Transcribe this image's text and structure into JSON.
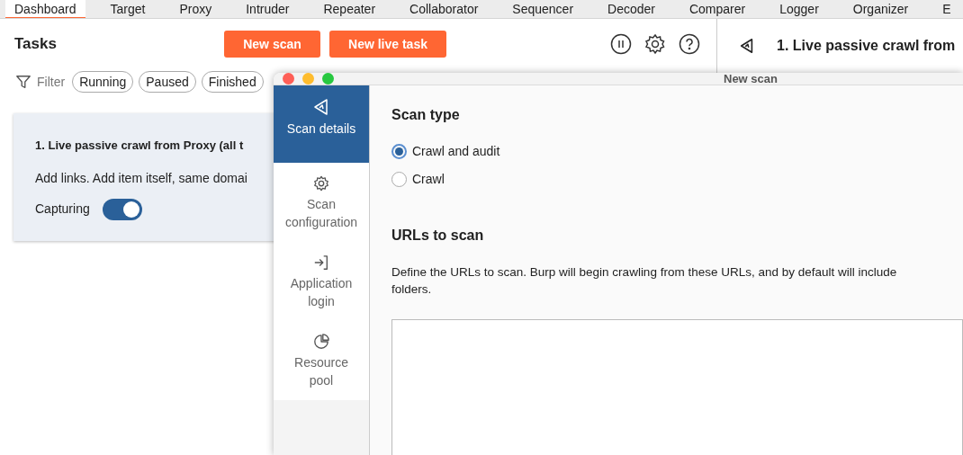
{
  "tabs": [
    {
      "label": "Dashboard",
      "selected": true
    },
    {
      "label": "Target",
      "selected": false
    },
    {
      "label": "Proxy",
      "selected": false
    },
    {
      "label": "Intruder",
      "selected": false
    },
    {
      "label": "Repeater",
      "selected": false
    },
    {
      "label": "Collaborator",
      "selected": false
    },
    {
      "label": "Sequencer",
      "selected": false
    },
    {
      "label": "Decoder",
      "selected": false
    },
    {
      "label": "Comparer",
      "selected": false
    },
    {
      "label": "Logger",
      "selected": false
    },
    {
      "label": "Organizer",
      "selected": false
    },
    {
      "label": "E",
      "selected": false
    }
  ],
  "tasks": {
    "title": "Tasks",
    "buttons": [
      "New scan",
      "New live task"
    ],
    "filter_label": "Filter",
    "filters": [
      "Running",
      "Paused",
      "Finished"
    ],
    "card": {
      "title": "1. Live passive crawl from Proxy (all t",
      "description": "Add links. Add item itself, same domai",
      "toggle_label": "Capturing",
      "on": true
    }
  },
  "detail_panel": {
    "title": "1. Live passive crawl from"
  },
  "dialog": {
    "title": "New scan",
    "nav": [
      {
        "label": "Scan details",
        "kind": "crawl",
        "selected": true
      },
      {
        "label": "Scan configuration",
        "kind": "gear",
        "selected": false
      },
      {
        "label": "Application login",
        "kind": "login",
        "selected": false
      },
      {
        "label": "Resource pool",
        "kind": "pie",
        "selected": false
      }
    ],
    "scan_type": {
      "heading": "Scan type",
      "options": [
        {
          "label": "Crawl and audit",
          "selected": true
        },
        {
          "label": "Crawl",
          "selected": false
        }
      ]
    },
    "urls": {
      "heading": "URLs to scan",
      "description_lines": [
        "Define the URLs to scan. Burp will begin crawling from these URLs, and by default will include",
        "folders."
      ]
    }
  }
}
